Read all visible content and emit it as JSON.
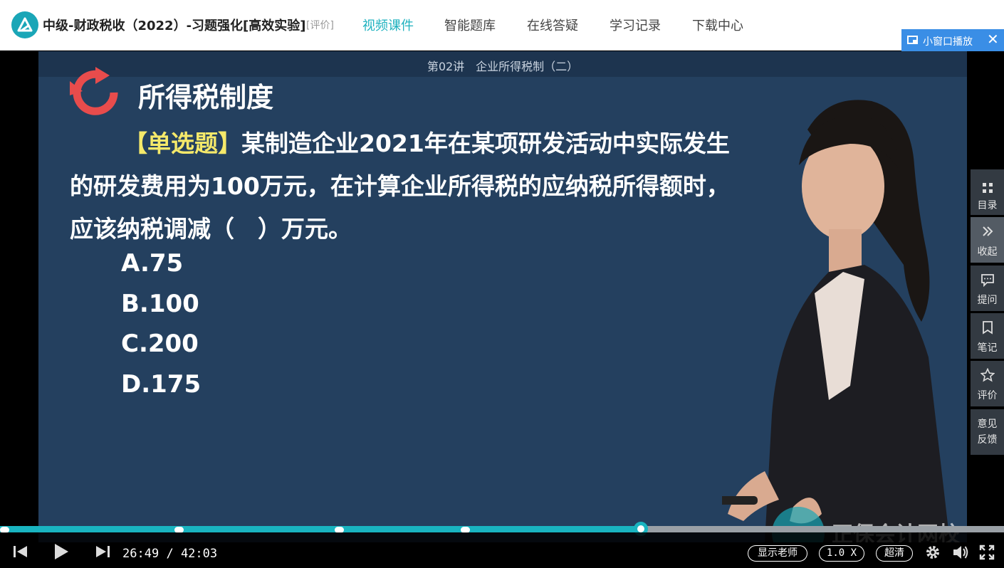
{
  "header": {
    "course_title": "中级-财政税收（2022）-习题强化[高效实验]",
    "rate_link": "[评价]",
    "nav": [
      "视频课件",
      "智能题库",
      "在线答疑",
      "学习记录",
      "下载中心"
    ],
    "mini_player_label": "小窗口播放",
    "mini_player_close": "✕"
  },
  "slide": {
    "lecture_title": "第02讲　企业所得税制（二）",
    "heading": "所得税制度",
    "question_tag": "【单选题】",
    "question_text": "某制造企业2021年在某项研发活动中实际发生的研发费用为100万元，在计算企业所得税的应纳税所得额时，应该纳税调减（　）万元。",
    "options": [
      "A.75",
      "B.100",
      "C.200",
      "D.175"
    ],
    "watermark": "正保会计网校"
  },
  "side_panel": [
    {
      "label": "目录",
      "icon": "grid-icon"
    },
    {
      "label": "收起",
      "icon": "chevron-double-right-icon"
    },
    {
      "label": "提问",
      "icon": "chat-icon"
    },
    {
      "label": "笔记",
      "icon": "bookmark-icon"
    },
    {
      "label": "评价",
      "icon": "star-icon"
    },
    {
      "label": "意见反馈",
      "icon": "feedback-icon"
    }
  ],
  "player": {
    "current_time": "26:49",
    "separator": "/",
    "total_time": "42:03",
    "progress_fraction": 0.638,
    "show_teacher": "显示老师",
    "speed": "1.0 X",
    "quality": "超清",
    "accent_color": "#19b4c0"
  }
}
